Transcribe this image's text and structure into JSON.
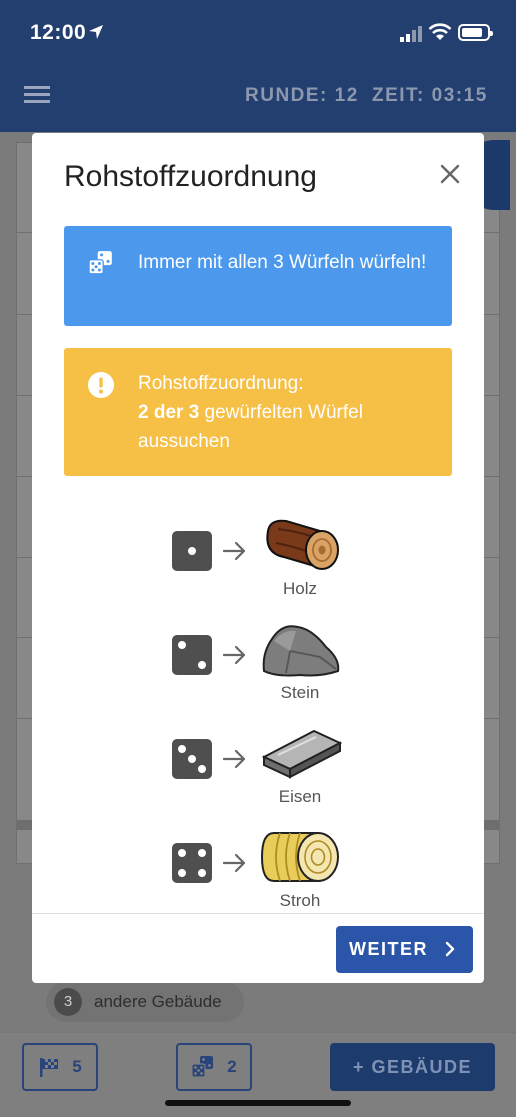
{
  "status_bar": {
    "time": "12:00"
  },
  "app_bar": {
    "round": "RUNDE: 12",
    "timer": "ZEIT: 03:15"
  },
  "background": {
    "chip": {
      "count": "3",
      "label": "andere Gebäude"
    },
    "bottom": {
      "flags": "5",
      "dice": "2",
      "build": "+ GEBÄUDE"
    }
  },
  "modal": {
    "title": "Rohstoffzuordnung",
    "info": "Immer mit allen 3 Würfeln würfeln!",
    "warning": {
      "line1": "Rohstoffzuordnung:",
      "bold": "2 der 3",
      "rest": " gewürfelten Würfel aussuchen"
    },
    "resources": [
      {
        "die": 1,
        "label": "Holz",
        "icon": "log-icon"
      },
      {
        "die": 2,
        "label": "Stein",
        "icon": "stone-icon"
      },
      {
        "die": 3,
        "label": "Eisen",
        "icon": "iron-ingot-icon"
      },
      {
        "die": 4,
        "label": "Stroh",
        "icon": "straw-bale-icon"
      }
    ],
    "next_button": "WEITER"
  },
  "colors": {
    "primary": "#223f70",
    "info": "#4b98ec",
    "warning": "#f6bf45",
    "button": "#2b55a8"
  }
}
